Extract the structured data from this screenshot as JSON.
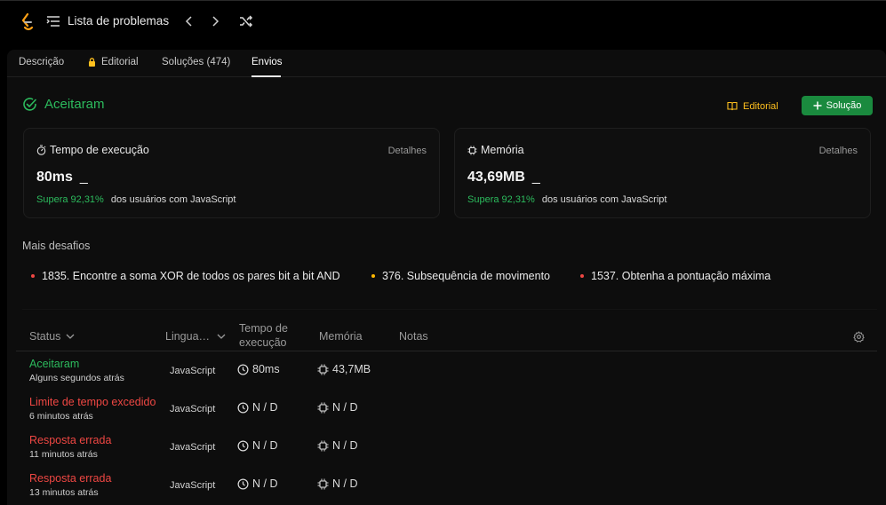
{
  "header": {
    "list_title": "Lista de problemas"
  },
  "tabs": [
    {
      "label": "Descrição"
    },
    {
      "label": "Editorial"
    },
    {
      "label": "Soluções (474)"
    },
    {
      "label": "Envios"
    }
  ],
  "result": {
    "status": "Aceitaram",
    "editorial_label": "Editorial",
    "solution_label": "Solução"
  },
  "runtime_card": {
    "label": "Tempo de execução",
    "details": "Detalhes",
    "value": "80ms",
    "cursor": "_",
    "beats_pct": "Supera 92,31%",
    "beats_text": "dos usuários com JavaScript"
  },
  "memory_card": {
    "label": "Memória",
    "details": "Detalhes",
    "value": "43,69MB",
    "cursor": "_",
    "beats_pct": "Supera 92,31%",
    "beats_text": "dos usuários com JavaScript"
  },
  "more": {
    "title": "Mais desafios",
    "items": [
      {
        "label": "1835. Encontre a soma XOR de todos os pares bit a bit AND",
        "color": "#ef4743"
      },
      {
        "label": "376. Subsequência de movimento",
        "color": "#ffb800"
      },
      {
        "label": "1537. Obtenha a pontuação máxima",
        "color": "#ef4743"
      }
    ]
  },
  "table": {
    "headers": {
      "status": "Status",
      "language": "Lingua…",
      "runtime_1": "Tempo de",
      "runtime_2": "execução",
      "memory": "Memória",
      "notes": "Notas"
    },
    "rows": [
      {
        "status": "Aceitaram",
        "status_color": "#2cbb5d",
        "time": "Alguns segundos atrás",
        "language": "JavaScript",
        "runtime": "80ms",
        "memory": "43,7MB"
      },
      {
        "status": "Limite de tempo excedido",
        "status_color": "#ef4743",
        "time": "6 minutos atrás",
        "language": "JavaScript",
        "runtime": "N / D",
        "memory": "N / D"
      },
      {
        "status": "Resposta errada",
        "status_color": "#ef4743",
        "time": "11 minutos atrás",
        "language": "JavaScript",
        "runtime": "N / D",
        "memory": "N / D"
      },
      {
        "status": "Resposta errada",
        "status_color": "#ef4743",
        "time": "13 minutos atrás",
        "language": "JavaScript",
        "runtime": "N / D",
        "memory": "N / D"
      }
    ]
  },
  "colors": {
    "accepted": "#2cbb5d",
    "error": "#ef4743",
    "accent": "#ffc01e"
  }
}
